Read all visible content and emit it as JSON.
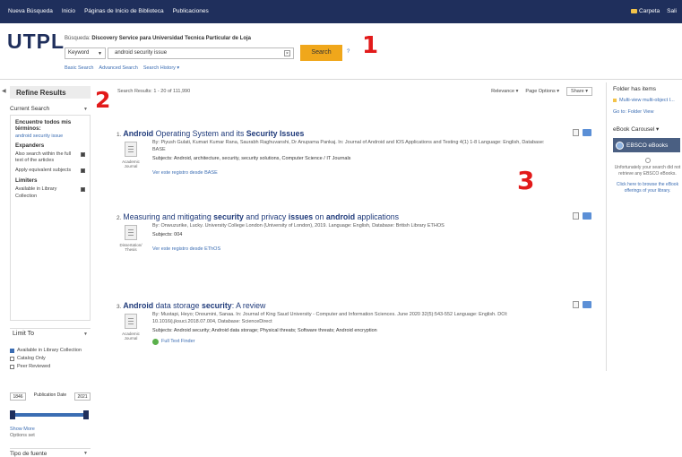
{
  "topnav": {
    "links": [
      "Nueva Búsqueda",
      "Inicio",
      "Páginas de Inicio de Biblioteca",
      "Publicaciones"
    ],
    "folder_label": "Carpeta",
    "exit_label": "Sali"
  },
  "logo": "UTPL",
  "search": {
    "searching_label": "Búsqueda:",
    "searching_scope": "Discovery Service para Universidad Tecnica Particular de Loja",
    "field_value": "Keyword",
    "query_value": "android security issue",
    "clear_label": "×",
    "search_button": "Search",
    "help_mark": "?",
    "links": [
      "Basic Search",
      "Advanced Search",
      "Search History ▾"
    ]
  },
  "annotations": [
    "1",
    "2",
    "3"
  ],
  "refine": {
    "title": "Refine Results",
    "current_search": "Current Search",
    "find_all_heading": "Encuentre todos mis términos:",
    "find_all_value": "android security issue",
    "expanders_heading": "Expanders",
    "expanders": [
      "Also search within the full text of the articles",
      "Apply equivalent subjects"
    ],
    "limiters_heading": "Limiters",
    "limiters": [
      "Available in Library Collection"
    ],
    "limit_to": "Limit To",
    "limit_options": [
      {
        "label": "Available in Library Collection",
        "checked": true
      },
      {
        "label": "Catalog Only",
        "checked": false
      },
      {
        "label": "Peer Reviewed",
        "checked": false
      }
    ],
    "date_from": "1846",
    "date_label": "Publication Date",
    "date_to": "2021",
    "show_more": "Show More",
    "options_set": "Options set",
    "pub_type": "Tipo de fuente"
  },
  "results_header": {
    "count_text": "Search Results: 1 - 20 of 111,990",
    "relevance": "Relevance ▾",
    "page_options": "Page Options ▾",
    "share": "Share ▾"
  },
  "results": [
    {
      "number": "1.",
      "title_parts": [
        "Android",
        " Operating System and its ",
        "Security",
        " ",
        "Issues"
      ],
      "type": "Academic Journal",
      "meta": "By: Piyush Gulati, Kumari Kumar Rana, Saurabh Raghuvanshi, Dr Anupama Pankaj. In: Journal of Android and IOS Applications and Testing 4(1) 1-8 Language: English, Database: BASE",
      "subjects": "Subjects: Android, architecture, security, security solutions, Computer Science / IT Journals",
      "link": "Ver este registro desde BASE"
    },
    {
      "number": "2.",
      "title_parts": [
        "Measuring and mitigating ",
        "security",
        " and privacy ",
        "issues",
        " on ",
        "android",
        " applications"
      ],
      "type": "Dissertation/ Thesis",
      "meta": "By: Onwuzurike, Lucky. University College London (University of London), 2019. Language: English, Database: British Library ETHOS",
      "subjects": "Subjects: 004",
      "link": "Ver este registro desde EThOS"
    },
    {
      "number": "3.",
      "title_parts": [
        "Android",
        " data storage ",
        "security",
        ": A review"
      ],
      "type": "Academic Journal",
      "meta": "By: Mustapi, Heyo; Onoumini, Sanaa. In: Journal of King Saud University - Computer and Information Sciences. June 2020 32(5):543-552 Language: English. DOI: 10.1016/j.jksuci.2018.07.004, Database: ScienceDirect",
      "subjects": "Subjects: Android security; Android data storage; Physical threats; Software threats; Android encryption",
      "link": "Full Text Finder"
    }
  ],
  "right_sidebar": {
    "folder_title": "Folder has items",
    "folder_items": "Multi-view multi-object I...",
    "folder_view": "Go to: Folder View",
    "ebook_carousel": "eBook Carousel ▾",
    "ebsco_label": "EBSCO eBooks",
    "ebsco_msg": "Unfortunately your search did not retrieve any EBSCO eBooks.",
    "browse_link": "Click here to browse the eBook offerings of your library."
  }
}
